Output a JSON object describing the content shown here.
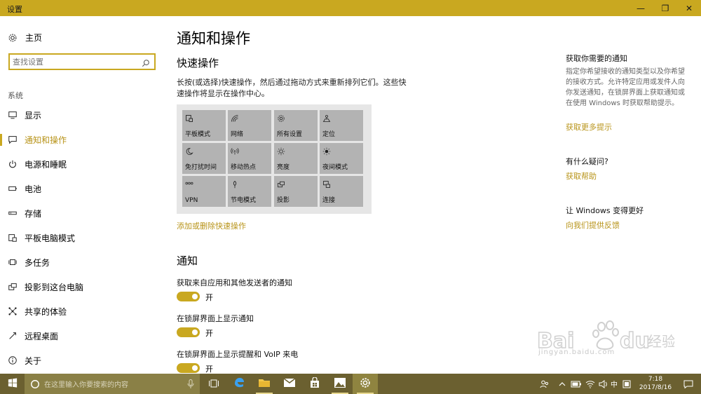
{
  "window": {
    "title": "设置",
    "minimize": "—",
    "maximize": "❐",
    "close": "✕"
  },
  "sidebar": {
    "home_label": "主页",
    "search_placeholder": "查找设置",
    "section_label": "系统",
    "items": [
      {
        "label": "显示",
        "icon": "display-icon"
      },
      {
        "label": "通知和操作",
        "icon": "notification-icon",
        "active": true
      },
      {
        "label": "电源和睡眠",
        "icon": "power-icon"
      },
      {
        "label": "电池",
        "icon": "battery-icon"
      },
      {
        "label": "存储",
        "icon": "storage-icon"
      },
      {
        "label": "平板电脑模式",
        "icon": "tablet-icon"
      },
      {
        "label": "多任务",
        "icon": "multitask-icon"
      },
      {
        "label": "投影到这台电脑",
        "icon": "project-icon"
      },
      {
        "label": "共享的体验",
        "icon": "share-icon"
      },
      {
        "label": "远程桌面",
        "icon": "remote-icon"
      },
      {
        "label": "关于",
        "icon": "info-icon"
      }
    ]
  },
  "main": {
    "title": "通知和操作",
    "quick_actions": {
      "heading": "快速操作",
      "description": "长按(或选择)快速操作，然后通过拖动方式来重新排列它们。这些快速操作将显示在操作中心。",
      "tiles": [
        {
          "label": "平板模式",
          "icon": "tablet-mode-icon"
        },
        {
          "label": "网络",
          "icon": "network-icon"
        },
        {
          "label": "所有设置",
          "icon": "gear-icon"
        },
        {
          "label": "定位",
          "icon": "location-icon"
        },
        {
          "label": "免打扰时间",
          "icon": "moon-icon"
        },
        {
          "label": "移动热点",
          "icon": "hotspot-icon"
        },
        {
          "label": "亮度",
          "icon": "brightness-icon"
        },
        {
          "label": "夜间模式",
          "icon": "night-light-icon"
        },
        {
          "label": "VPN",
          "icon": "vpn-icon"
        },
        {
          "label": "节电模式",
          "icon": "battery-saver-icon"
        },
        {
          "label": "投影",
          "icon": "project-icon"
        },
        {
          "label": "连接",
          "icon": "connect-icon"
        }
      ],
      "edit_link": "添加或删除快速操作"
    },
    "notifications": {
      "heading": "通知",
      "settings": [
        {
          "label": "获取来自应用和其他发送者的通知",
          "state": "开"
        },
        {
          "label": "在锁屏界面上显示通知",
          "state": "开"
        },
        {
          "label": "在锁屏界面上显示提醒和 VoIP 来电",
          "state": "开"
        }
      ]
    }
  },
  "right": {
    "tips_heading": "获取你需要的通知",
    "tips_text": "指定你希望接收的通知类型以及你希望的接收方式。允许特定应用或发件人向你发送通知，在锁屏界面上获取通知或在使用 Windows 时获取帮助提示。",
    "tips_link": "获取更多提示",
    "question_heading": "有什么疑问?",
    "help_link": "获取帮助",
    "improve_heading": "让 Windows 变得更好",
    "feedback_link": "向我们提供反馈"
  },
  "taskbar": {
    "search_placeholder": "在这里输入你要搜索的内容",
    "ime": "中",
    "time": "7:18",
    "date": "2017/8/16"
  },
  "watermark": {
    "url_text": "jingyan.baidu.com"
  },
  "colors": {
    "accent": "#c9a820",
    "taskbar": "#6b6030",
    "link": "#b8941a"
  }
}
